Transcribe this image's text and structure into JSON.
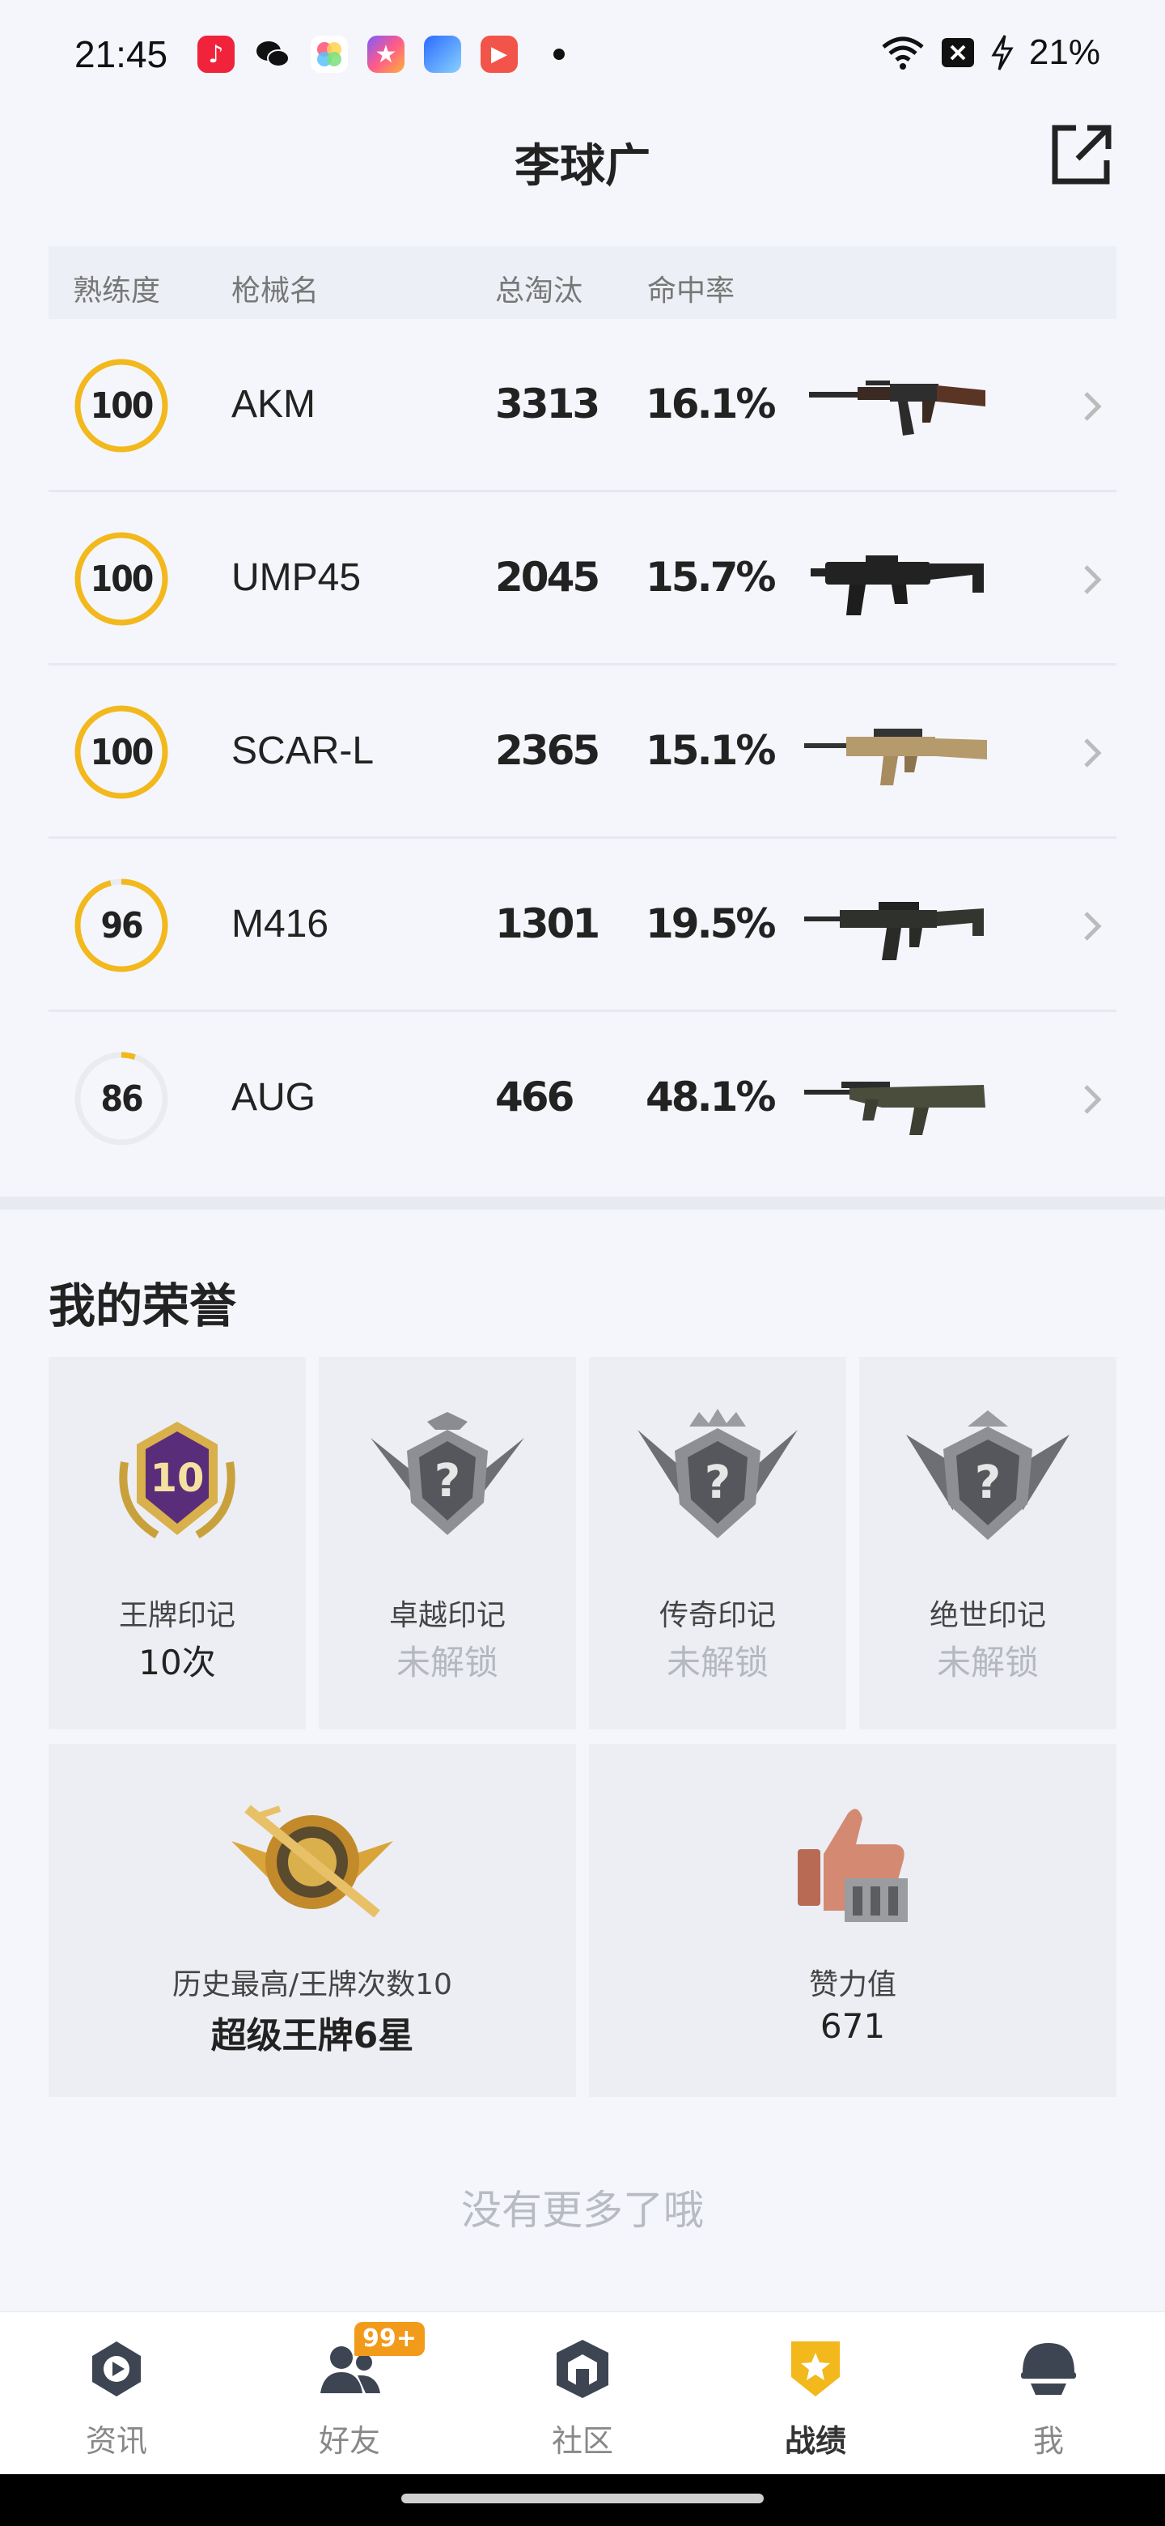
{
  "status_bar": {
    "time": "21:45",
    "battery": "21%",
    "app_icons": [
      "music-app-icon",
      "wechat-icon",
      "photos-app-icon",
      "star-app-icon",
      "game-app-icon",
      "video-app-icon"
    ]
  },
  "header": {
    "title": "李球广"
  },
  "table": {
    "headers": {
      "mastery": "熟练度",
      "weapon": "枪械名",
      "kills": "总淘汰",
      "accuracy": "命中率"
    },
    "rows": [
      {
        "mastery": "100",
        "mastery_fraction": 1.0,
        "name": "AKM",
        "kills": "3313",
        "accuracy": "16.1%",
        "gun_icon": "akm-rifle-icon"
      },
      {
        "mastery": "100",
        "mastery_fraction": 1.0,
        "name": "UMP45",
        "kills": "2045",
        "accuracy": "15.7%",
        "gun_icon": "ump45-smg-icon"
      },
      {
        "mastery": "100",
        "mastery_fraction": 1.0,
        "name": "SCAR-L",
        "kills": "2365",
        "accuracy": "15.1%",
        "gun_icon": "scarl-rifle-icon"
      },
      {
        "mastery": "96",
        "mastery_fraction": 0.96,
        "name": "M416",
        "kills": "1301",
        "accuracy": "19.5%",
        "gun_icon": "m416-rifle-icon"
      },
      {
        "mastery": "86",
        "mastery_fraction": 0.05,
        "name": "AUG",
        "kills": "466",
        "accuracy": "48.1%",
        "gun_icon": "aug-rifle-icon"
      }
    ]
  },
  "honors": {
    "title": "我的荣誉",
    "marks": [
      {
        "name": "王牌印记",
        "value": "10次",
        "locked": false,
        "icon": "ace-mark-badge-icon",
        "badge_number": "10"
      },
      {
        "name": "卓越印记",
        "value": "未解锁",
        "locked": true,
        "icon": "excellence-mark-badge-icon"
      },
      {
        "name": "传奇印记",
        "value": "未解锁",
        "locked": true,
        "icon": "legend-mark-badge-icon"
      },
      {
        "name": "绝世印记",
        "value": "未解锁",
        "locked": true,
        "icon": "peerless-mark-badge-icon"
      }
    ],
    "stats": [
      {
        "label": "历史最高/王牌次数10",
        "value": "超级王牌6星",
        "icon": "super-ace-badge-icon"
      },
      {
        "label": "赞力值",
        "value": "671",
        "icon": "thumbs-up-trophy-icon"
      }
    ]
  },
  "footer_note": "没有更多了哦",
  "bottom_nav": {
    "items": [
      {
        "label": "资讯",
        "icon": "news-icon",
        "active": false
      },
      {
        "label": "好友",
        "icon": "friends-icon",
        "active": false,
        "badge": "99+"
      },
      {
        "label": "社区",
        "icon": "community-icon",
        "active": false
      },
      {
        "label": "战绩",
        "icon": "stats-icon",
        "active": true
      },
      {
        "label": "我",
        "icon": "profile-helmet-icon",
        "active": false
      }
    ]
  },
  "colors": {
    "accent_gold": "#f2b81c",
    "ring_track": "#e9ebef",
    "page_bg": "#f4f6fb",
    "card_bg": "#eceef3",
    "badge_orange": "#f29a1a"
  }
}
